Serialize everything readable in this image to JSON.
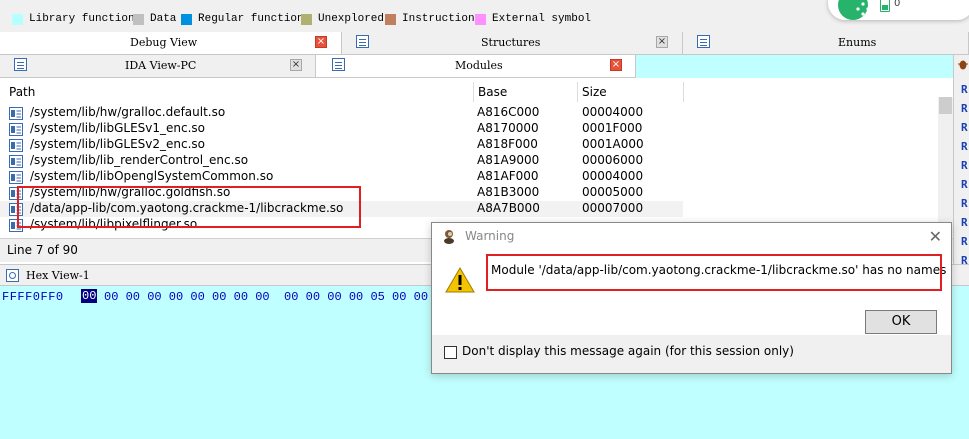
{
  "legend": {
    "items": [
      {
        "label": "Library function",
        "color": "#b4ffff"
      },
      {
        "label": "Data",
        "color": "#c0c0c0"
      },
      {
        "label": "Regular function",
        "color": "#0090e0"
      },
      {
        "label": "Unexplored",
        "color": "#b0b070"
      },
      {
        "label": "Instruction",
        "color": "#c08060"
      },
      {
        "label": "External symbol",
        "color": "#ff90ff"
      }
    ]
  },
  "status_pill": {
    "count": "0",
    "icon": "battery-icon"
  },
  "top_tabs": [
    {
      "label": "Debug View",
      "close": "×"
    },
    {
      "label": "Structures",
      "close": "×"
    },
    {
      "label": "Enums"
    }
  ],
  "second_tabs": [
    {
      "label": "IDA View-PC",
      "close": "×"
    },
    {
      "label": "Modules",
      "close": "×"
    }
  ],
  "modules": {
    "columns": {
      "path": "Path",
      "base": "Base",
      "size": "Size"
    },
    "rows": [
      {
        "path": "/system/lib/hw/gralloc.default.so",
        "base": "A816C000",
        "size": "00004000"
      },
      {
        "path": "/system/lib/libGLESv1_enc.so",
        "base": "A8170000",
        "size": "0001F000"
      },
      {
        "path": "/system/lib/libGLESv2_enc.so",
        "base": "A818F000",
        "size": "0001A000"
      },
      {
        "path": "/system/lib/lib_renderControl_enc.so",
        "base": "A81A9000",
        "size": "00006000"
      },
      {
        "path": "/system/lib/libOpenglSystemCommon.so",
        "base": "A81AF000",
        "size": "00004000"
      },
      {
        "path": "/system/lib/hw/gralloc.goldfish.so",
        "base": "A81B3000",
        "size": "00005000"
      },
      {
        "path": "/data/app-lib/com.yaotong.crackme-1/libcrackme.so",
        "base": "A8A7B000",
        "size": "00007000"
      },
      {
        "path": "/system/lib/libpixelflinger.so",
        "base": "",
        "size": ""
      }
    ],
    "status": "Line 7 of 90"
  },
  "right_strip": {
    "letters": [
      "R",
      "R",
      "R",
      "R",
      "R",
      "R",
      "R",
      "R",
      "R",
      "R"
    ]
  },
  "hex_view": {
    "title": "Hex View-1",
    "address": "FFFF0FF0",
    "cursor_byte": "00",
    "bytes": "00 00 00 00 00 00 00 00  00 00 00 00 05 00 00"
  },
  "dialog": {
    "title": "Warning",
    "close": "✕",
    "message": "Module '/data/app-lib/com.yaotong.crackme-1/libcrackme.so' has no names",
    "ok": "OK",
    "checkbox_label": "Don't display this message again (for this session only)"
  }
}
